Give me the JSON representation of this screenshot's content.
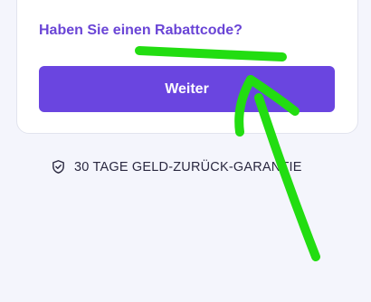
{
  "discount_link": "Haben Sie einen Rabattcode?",
  "continue_button": "Weiter",
  "guarantee": {
    "icon": "shield-check-icon",
    "text": "30 TAGE GELD-ZURÜCK-GARANTIE"
  },
  "colors": {
    "accent": "#6a45e0",
    "link": "#6a45d6",
    "annotation": "#22dd11",
    "background": "#f4f5fc"
  }
}
